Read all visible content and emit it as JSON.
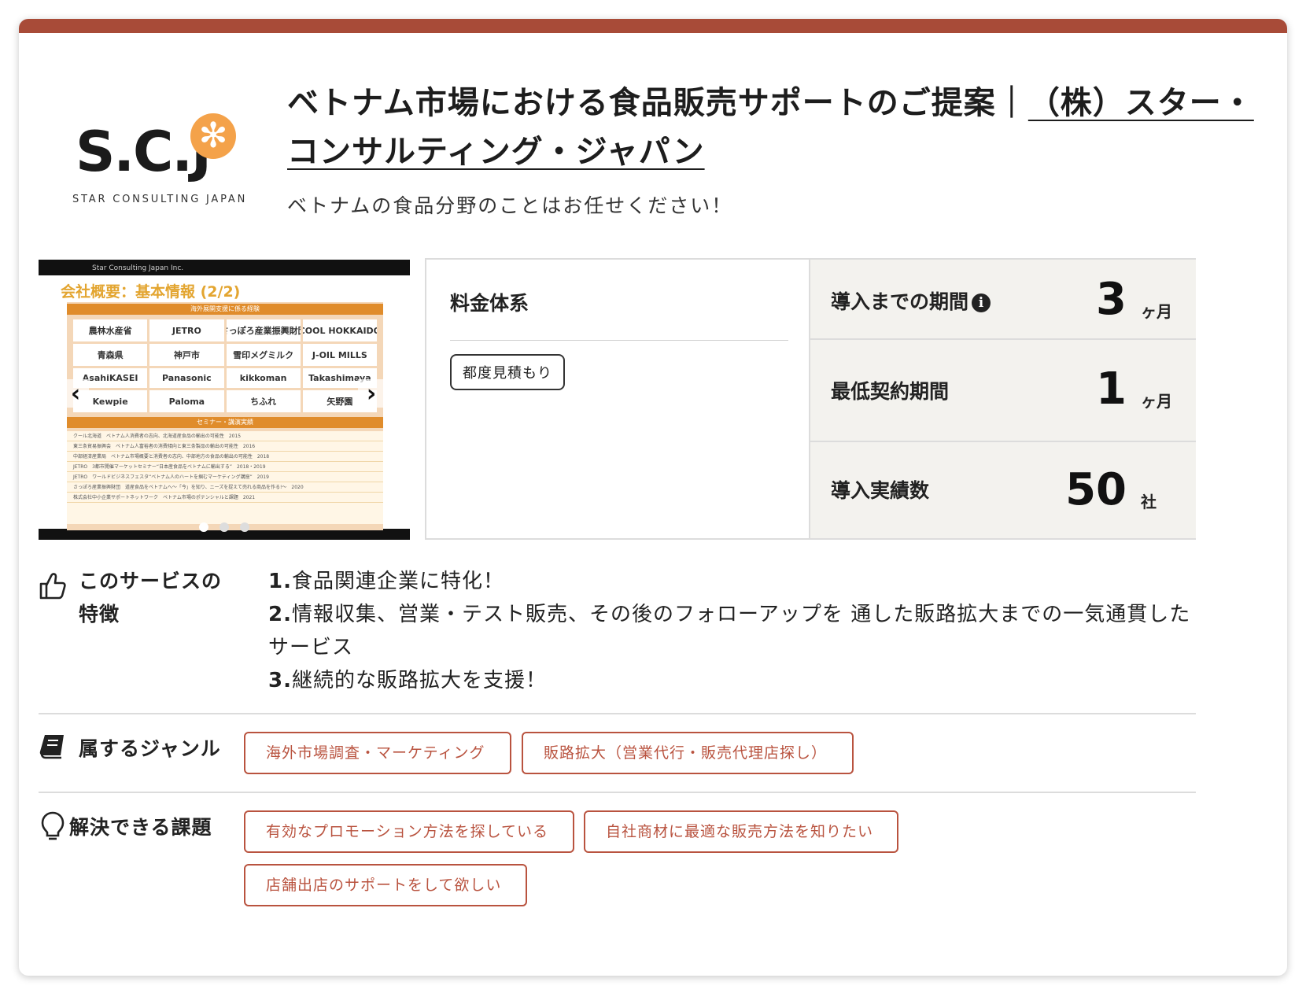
{
  "logo": {
    "mark": "S.C.J",
    "tagline": "STAR CONSULTING JAPAN"
  },
  "header": {
    "title_prefix": "ベトナム市場における食品販売サポートのご提案｜",
    "title_link": "（株）スター・コンサルティング・ジャパン",
    "subtitle": "ベトナムの食品分野のことはお任せください！"
  },
  "slider": {
    "company_line": "Star Consulting Japan Inc.",
    "slide_title": "会社概要：基本情報 (2/2)",
    "band_top": "海外展開支援に係る経験",
    "logos": [
      "農林水産省",
      "JETRO",
      "さっぽろ産業振興財団",
      "COOL HOKKAIDO",
      "青森県",
      "神戸市",
      "雪印メグミルク",
      "J-OIL MILLS",
      "AsahiKASEI",
      "Panasonic",
      "kikkoman",
      "Takashimaya",
      "Kewpie",
      "Paloma",
      "ちふれ",
      "矢野園"
    ],
    "band_bottom": "セミナー・講演実績",
    "seminar_rows": [
      "クール北海道　ベトナム人消費者の志向、北海道産食品の輸出の可能性　2015",
      "東三条貿易振興会　ベトナム人富裕者の消費傾向と東三条製品の輸出の可能性　2016",
      "中部経済産業局　ベトナム市場概要と消費者の志向、中部地方の食品の輸出の可能性　2018",
      "JETRO　3都市開催マーケットセミナー“日本産食品をベトナムに輸出する”　2018・2019",
      "JETRO　ワールドビジネスフェスタ“ベトナム人のハートを掴むマーケティング講座”　2019",
      "さっぽろ産業振興財団　道産食品をベトナムへ～「今」を知り、ニーズを捉えて売れる商品を作る!～　2020",
      "株式会社中小企業サポートネットワーク　ベトナム市場のポテンシャルと課題　2021"
    ],
    "page_number": "3",
    "active_index": 0,
    "slide_count": 3
  },
  "pricing": {
    "fee_label": "料金体系",
    "fee_value": "都度見積もり",
    "rows": [
      {
        "label": "導入までの期間",
        "value": "3",
        "unit": "ヶ月",
        "has_info_icon": true
      },
      {
        "label": "最低契約期間",
        "value": "1",
        "unit": "ヶ月"
      },
      {
        "label": "導入実績数",
        "value": "50",
        "unit": "社"
      }
    ]
  },
  "features": {
    "heading_line1": "このサービスの",
    "heading_line2": "特徴",
    "items": [
      {
        "num": "1.",
        "text": "食品関連企業に特化！"
      },
      {
        "num": "2.",
        "text": "情報収集、営業・テスト販売、その後のフォローアップを 通した販路拡大までの一気通貫したサービス"
      },
      {
        "num": "3.",
        "text": "継続的な販路拡大を支援！"
      }
    ]
  },
  "genres": {
    "heading": "属するジャンル",
    "tags": [
      "海外市場調査・マーケティング",
      "販路拡大（営業代行・販売代理店探し）"
    ]
  },
  "issues": {
    "heading": "解決できる課題",
    "tags": [
      "有効なプロモーション方法を探している",
      "自社商材に最適な販売方法を知りたい",
      "店舗出店のサポートをして欲しい"
    ]
  },
  "colors": {
    "accent": "#a84b38",
    "tag": "#b9533f",
    "stat_bg": "#f3f2ee",
    "logo_star": "#f4a24a"
  },
  "icons": {
    "features": "thumbs-up-icon",
    "genres": "book-icon",
    "issues": "lightbulb-icon",
    "info": "info-icon",
    "prev": "chevron-left-icon",
    "next": "chevron-right-icon"
  }
}
